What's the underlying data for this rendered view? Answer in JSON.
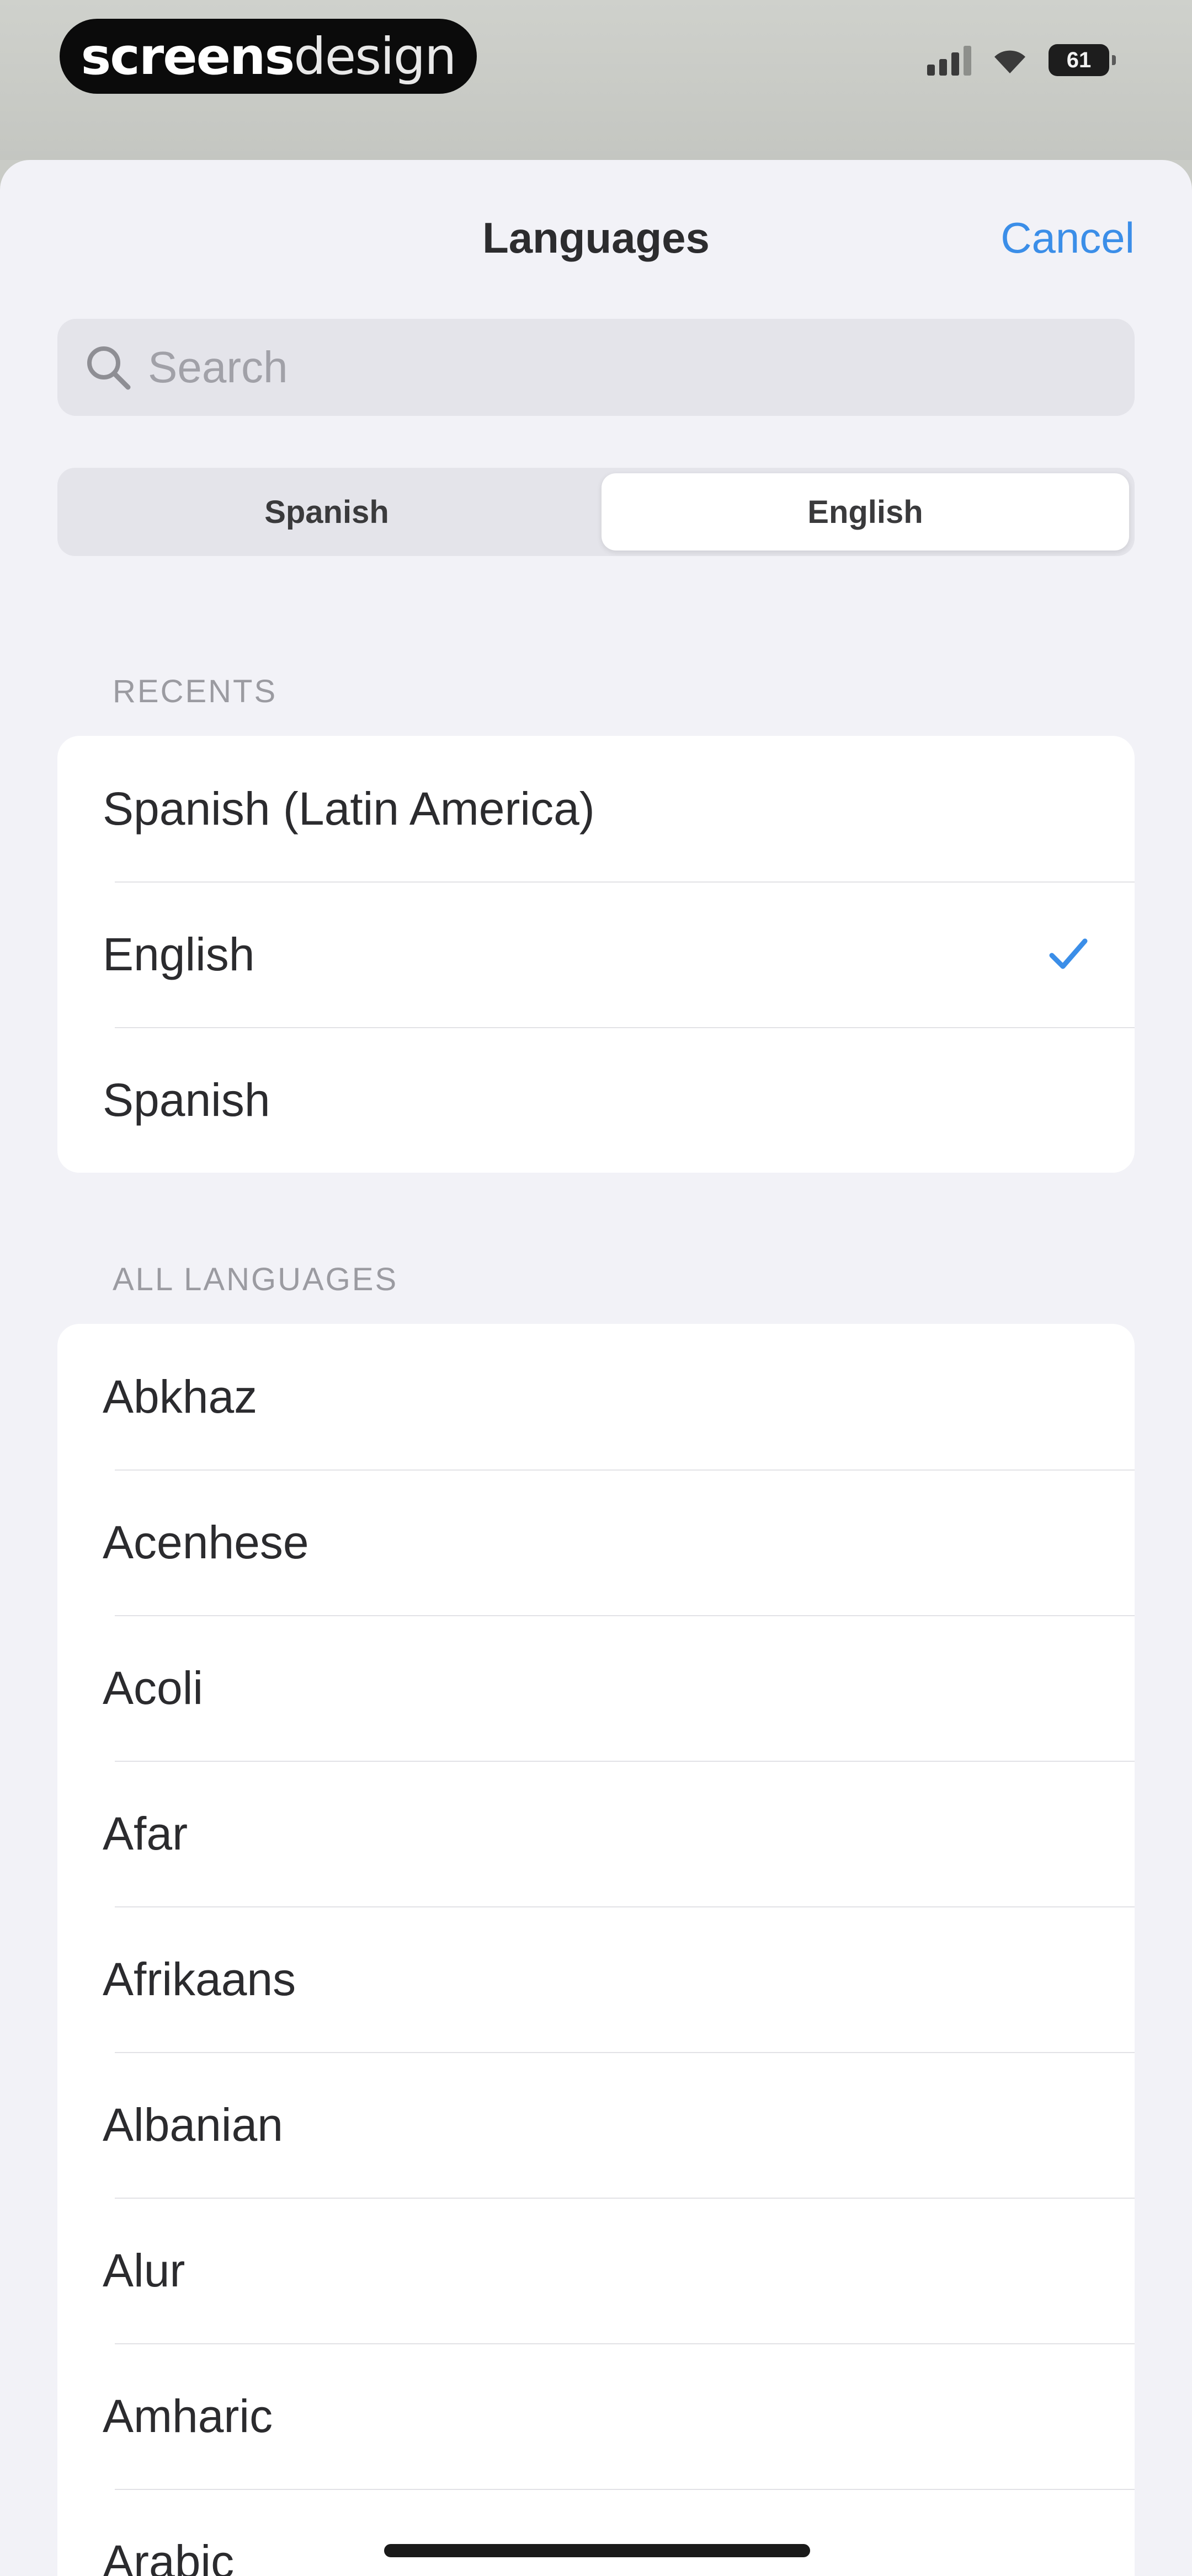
{
  "status_bar": {
    "brand_bold": "screens",
    "brand_thin": "design",
    "battery": "61"
  },
  "sheet": {
    "title": "Languages",
    "cancel_label": "Cancel"
  },
  "search": {
    "placeholder": "Search"
  },
  "segments": [
    {
      "label": "Spanish",
      "selected": false
    },
    {
      "label": "English",
      "selected": true
    }
  ],
  "recents": {
    "header": "RECENTS",
    "items": [
      {
        "label": "Spanish (Latin America)",
        "checked": false
      },
      {
        "label": "English",
        "checked": true
      },
      {
        "label": "Spanish",
        "checked": false
      }
    ]
  },
  "all_languages": {
    "header": "ALL LANGUAGES",
    "items": [
      {
        "label": "Abkhaz"
      },
      {
        "label": "Acenhese"
      },
      {
        "label": "Acoli"
      },
      {
        "label": "Afar"
      },
      {
        "label": "Afrikaans"
      },
      {
        "label": "Albanian"
      },
      {
        "label": "Alur"
      },
      {
        "label": "Amharic"
      },
      {
        "label": "Arabic"
      }
    ]
  },
  "colors": {
    "accent": "#3b8ee8",
    "sheet_background": "#f2f2f7",
    "row_background": "#ffffff"
  },
  "icons": {
    "search": "search-icon",
    "checkmark": "checkmark-icon",
    "wifi": "wifi-icon",
    "signal": "cellular-signal-icon"
  }
}
